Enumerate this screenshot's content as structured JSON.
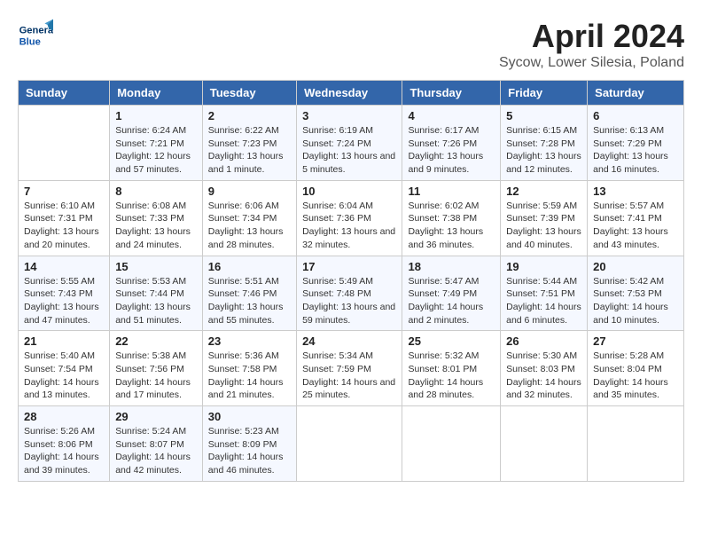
{
  "header": {
    "logo_line1": "General",
    "logo_line2": "Blue",
    "month": "April 2024",
    "location": "Sycow, Lower Silesia, Poland"
  },
  "weekdays": [
    "Sunday",
    "Monday",
    "Tuesday",
    "Wednesday",
    "Thursday",
    "Friday",
    "Saturday"
  ],
  "weeks": [
    [
      {
        "day": "",
        "sunrise": "",
        "sunset": "",
        "daylight": ""
      },
      {
        "day": "1",
        "sunrise": "Sunrise: 6:24 AM",
        "sunset": "Sunset: 7:21 PM",
        "daylight": "Daylight: 12 hours and 57 minutes."
      },
      {
        "day": "2",
        "sunrise": "Sunrise: 6:22 AM",
        "sunset": "Sunset: 7:23 PM",
        "daylight": "Daylight: 13 hours and 1 minute."
      },
      {
        "day": "3",
        "sunrise": "Sunrise: 6:19 AM",
        "sunset": "Sunset: 7:24 PM",
        "daylight": "Daylight: 13 hours and 5 minutes."
      },
      {
        "day": "4",
        "sunrise": "Sunrise: 6:17 AM",
        "sunset": "Sunset: 7:26 PM",
        "daylight": "Daylight: 13 hours and 9 minutes."
      },
      {
        "day": "5",
        "sunrise": "Sunrise: 6:15 AM",
        "sunset": "Sunset: 7:28 PM",
        "daylight": "Daylight: 13 hours and 12 minutes."
      },
      {
        "day": "6",
        "sunrise": "Sunrise: 6:13 AM",
        "sunset": "Sunset: 7:29 PM",
        "daylight": "Daylight: 13 hours and 16 minutes."
      }
    ],
    [
      {
        "day": "7",
        "sunrise": "Sunrise: 6:10 AM",
        "sunset": "Sunset: 7:31 PM",
        "daylight": "Daylight: 13 hours and 20 minutes."
      },
      {
        "day": "8",
        "sunrise": "Sunrise: 6:08 AM",
        "sunset": "Sunset: 7:33 PM",
        "daylight": "Daylight: 13 hours and 24 minutes."
      },
      {
        "day": "9",
        "sunrise": "Sunrise: 6:06 AM",
        "sunset": "Sunset: 7:34 PM",
        "daylight": "Daylight: 13 hours and 28 minutes."
      },
      {
        "day": "10",
        "sunrise": "Sunrise: 6:04 AM",
        "sunset": "Sunset: 7:36 PM",
        "daylight": "Daylight: 13 hours and 32 minutes."
      },
      {
        "day": "11",
        "sunrise": "Sunrise: 6:02 AM",
        "sunset": "Sunset: 7:38 PM",
        "daylight": "Daylight: 13 hours and 36 minutes."
      },
      {
        "day": "12",
        "sunrise": "Sunrise: 5:59 AM",
        "sunset": "Sunset: 7:39 PM",
        "daylight": "Daylight: 13 hours and 40 minutes."
      },
      {
        "day": "13",
        "sunrise": "Sunrise: 5:57 AM",
        "sunset": "Sunset: 7:41 PM",
        "daylight": "Daylight: 13 hours and 43 minutes."
      }
    ],
    [
      {
        "day": "14",
        "sunrise": "Sunrise: 5:55 AM",
        "sunset": "Sunset: 7:43 PM",
        "daylight": "Daylight: 13 hours and 47 minutes."
      },
      {
        "day": "15",
        "sunrise": "Sunrise: 5:53 AM",
        "sunset": "Sunset: 7:44 PM",
        "daylight": "Daylight: 13 hours and 51 minutes."
      },
      {
        "day": "16",
        "sunrise": "Sunrise: 5:51 AM",
        "sunset": "Sunset: 7:46 PM",
        "daylight": "Daylight: 13 hours and 55 minutes."
      },
      {
        "day": "17",
        "sunrise": "Sunrise: 5:49 AM",
        "sunset": "Sunset: 7:48 PM",
        "daylight": "Daylight: 13 hours and 59 minutes."
      },
      {
        "day": "18",
        "sunrise": "Sunrise: 5:47 AM",
        "sunset": "Sunset: 7:49 PM",
        "daylight": "Daylight: 14 hours and 2 minutes."
      },
      {
        "day": "19",
        "sunrise": "Sunrise: 5:44 AM",
        "sunset": "Sunset: 7:51 PM",
        "daylight": "Daylight: 14 hours and 6 minutes."
      },
      {
        "day": "20",
        "sunrise": "Sunrise: 5:42 AM",
        "sunset": "Sunset: 7:53 PM",
        "daylight": "Daylight: 14 hours and 10 minutes."
      }
    ],
    [
      {
        "day": "21",
        "sunrise": "Sunrise: 5:40 AM",
        "sunset": "Sunset: 7:54 PM",
        "daylight": "Daylight: 14 hours and 13 minutes."
      },
      {
        "day": "22",
        "sunrise": "Sunrise: 5:38 AM",
        "sunset": "Sunset: 7:56 PM",
        "daylight": "Daylight: 14 hours and 17 minutes."
      },
      {
        "day": "23",
        "sunrise": "Sunrise: 5:36 AM",
        "sunset": "Sunset: 7:58 PM",
        "daylight": "Daylight: 14 hours and 21 minutes."
      },
      {
        "day": "24",
        "sunrise": "Sunrise: 5:34 AM",
        "sunset": "Sunset: 7:59 PM",
        "daylight": "Daylight: 14 hours and 25 minutes."
      },
      {
        "day": "25",
        "sunrise": "Sunrise: 5:32 AM",
        "sunset": "Sunset: 8:01 PM",
        "daylight": "Daylight: 14 hours and 28 minutes."
      },
      {
        "day": "26",
        "sunrise": "Sunrise: 5:30 AM",
        "sunset": "Sunset: 8:03 PM",
        "daylight": "Daylight: 14 hours and 32 minutes."
      },
      {
        "day": "27",
        "sunrise": "Sunrise: 5:28 AM",
        "sunset": "Sunset: 8:04 PM",
        "daylight": "Daylight: 14 hours and 35 minutes."
      }
    ],
    [
      {
        "day": "28",
        "sunrise": "Sunrise: 5:26 AM",
        "sunset": "Sunset: 8:06 PM",
        "daylight": "Daylight: 14 hours and 39 minutes."
      },
      {
        "day": "29",
        "sunrise": "Sunrise: 5:24 AM",
        "sunset": "Sunset: 8:07 PM",
        "daylight": "Daylight: 14 hours and 42 minutes."
      },
      {
        "day": "30",
        "sunrise": "Sunrise: 5:23 AM",
        "sunset": "Sunset: 8:09 PM",
        "daylight": "Daylight: 14 hours and 46 minutes."
      },
      {
        "day": "",
        "sunrise": "",
        "sunset": "",
        "daylight": ""
      },
      {
        "day": "",
        "sunrise": "",
        "sunset": "",
        "daylight": ""
      },
      {
        "day": "",
        "sunrise": "",
        "sunset": "",
        "daylight": ""
      },
      {
        "day": "",
        "sunrise": "",
        "sunset": "",
        "daylight": ""
      }
    ]
  ]
}
